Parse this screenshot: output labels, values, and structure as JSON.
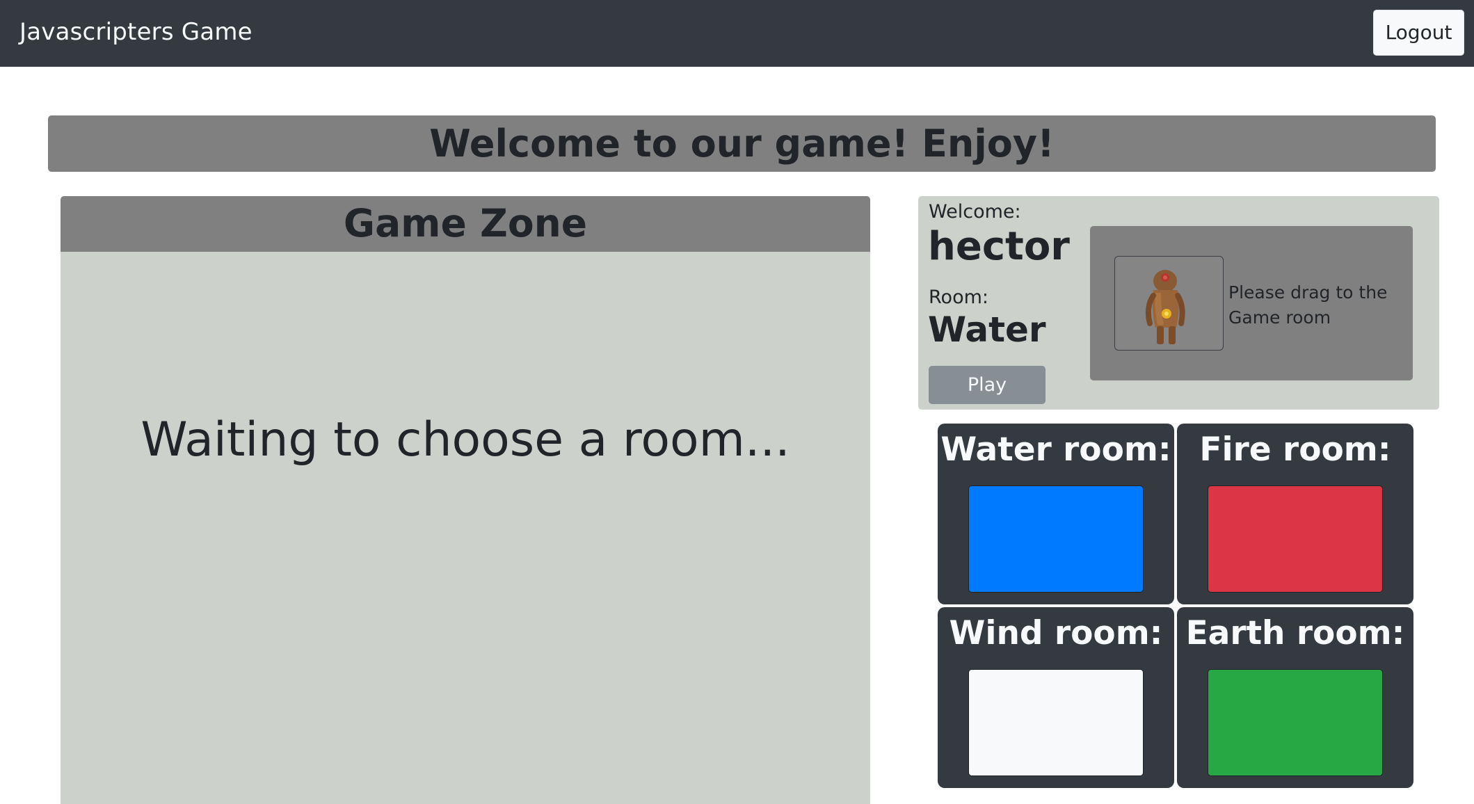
{
  "navbar": {
    "brand": "Javascripters Game",
    "logout_label": "Logout"
  },
  "banner": {
    "text": "Welcome to our game! Enjoy!"
  },
  "game_zone": {
    "title": "Game Zone",
    "status": "Waiting to choose a room..."
  },
  "user_panel": {
    "welcome_label": "Welcome:",
    "username": "hector",
    "room_label": "Room:",
    "room_value": "Water",
    "play_label": "Play",
    "drag_hint": "Please drag to the Game room",
    "avatar_icon": "robot-character-icon"
  },
  "rooms": [
    {
      "label": "Water room:",
      "color": "#007bff"
    },
    {
      "label": "Fire room:",
      "color": "#dc3545"
    },
    {
      "label": "Wind room:",
      "color": "#f8f9fa"
    },
    {
      "label": "Earth room:",
      "color": "#28a745"
    }
  ],
  "colors": {
    "navbar": "#343a40",
    "banner": "#808080",
    "panel": "#ccd1cb"
  }
}
